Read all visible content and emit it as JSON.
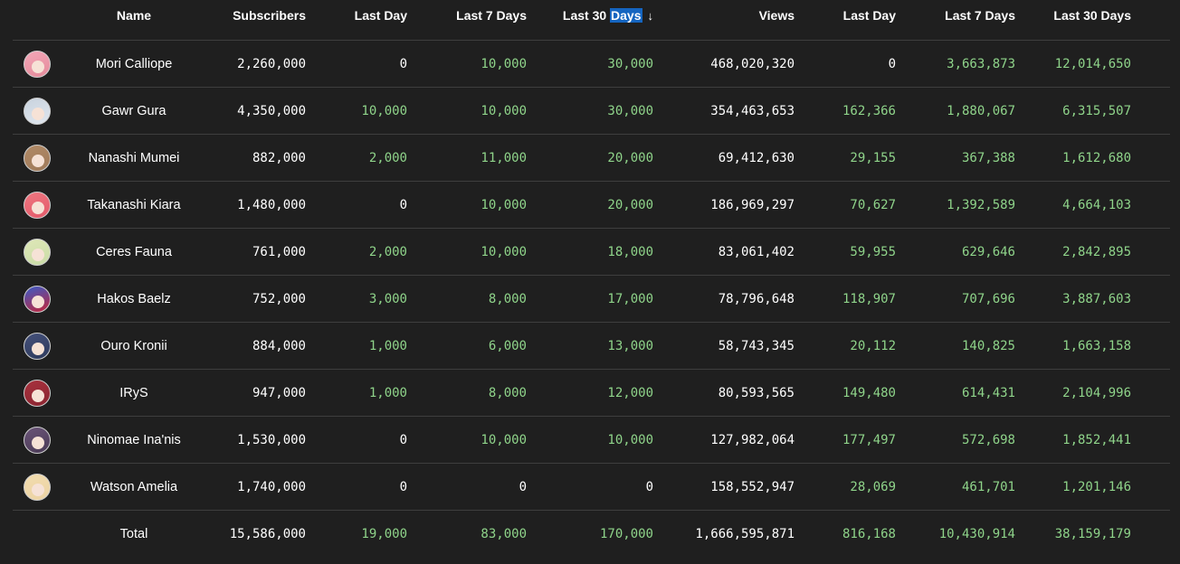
{
  "header": {
    "name": "Name",
    "subscribers": "Subscribers",
    "sub_last_day": "Last Day",
    "sub_last_7": "Last 7 Days",
    "sub_last_30_prefix": "Last 30 ",
    "sub_last_30_highlight": "Days",
    "sort_arrow": "↓",
    "views": "Views",
    "view_last_day": "Last Day",
    "view_last_7": "Last 7 Days",
    "view_last_30": "Last 30 Days"
  },
  "rows": [
    {
      "name": "Mori Calliope",
      "subs": "2,260,000",
      "sd1": "0",
      "sd7": "10,000",
      "sd30": "30,000",
      "views": "468,020,320",
      "vd1": "0",
      "vd7": "3,663,873",
      "vd30": "12,014,650",
      "avatar_bg": "#e58a9a",
      "avatar_hair": "#f2a7b8"
    },
    {
      "name": "Gawr Gura",
      "subs": "4,350,000",
      "sd1": "10,000",
      "sd7": "10,000",
      "sd30": "30,000",
      "views": "354,463,653",
      "vd1": "162,366",
      "vd7": "1,880,067",
      "vd30": "6,315,507",
      "avatar_bg": "#dfe6ee",
      "avatar_hair": "#c9d3de"
    },
    {
      "name": "Nanashi Mumei",
      "subs": "882,000",
      "sd1": "2,000",
      "sd7": "11,000",
      "sd30": "20,000",
      "views": "69,412,630",
      "vd1": "29,155",
      "vd7": "367,388",
      "vd30": "1,612,680",
      "avatar_bg": "#a07a5a",
      "avatar_hair": "#b08a66"
    },
    {
      "name": "Takanashi Kiara",
      "subs": "1,480,000",
      "sd1": "0",
      "sd7": "10,000",
      "sd30": "20,000",
      "views": "186,969,297",
      "vd1": "70,627",
      "vd7": "1,392,589",
      "vd30": "4,664,103",
      "avatar_bg": "#e35a6a",
      "avatar_hair": "#ee7680"
    },
    {
      "name": "Ceres Fauna",
      "subs": "761,000",
      "sd1": "2,000",
      "sd7": "10,000",
      "sd30": "18,000",
      "views": "83,061,402",
      "vd1": "59,955",
      "vd7": "629,646",
      "vd30": "2,842,895",
      "avatar_bg": "#c9dba6",
      "avatar_hair": "#dfe8b8"
    },
    {
      "name": "Hakos Baelz",
      "subs": "752,000",
      "sd1": "3,000",
      "sd7": "8,000",
      "sd30": "17,000",
      "views": "78,796,648",
      "vd1": "118,907",
      "vd7": "707,696",
      "vd30": "3,887,603",
      "avatar_bg": "#c2253a",
      "avatar_hair": "#3a5bc7"
    },
    {
      "name": "Ouro Kronii",
      "subs": "884,000",
      "sd1": "1,000",
      "sd7": "6,000",
      "sd30": "13,000",
      "views": "58,743,345",
      "vd1": "20,112",
      "vd7": "140,825",
      "vd30": "1,663,158",
      "avatar_bg": "#2e3a5c",
      "avatar_hair": "#44507a"
    },
    {
      "name": "IRyS",
      "subs": "947,000",
      "sd1": "1,000",
      "sd7": "8,000",
      "sd30": "12,000",
      "views": "80,593,565",
      "vd1": "149,480",
      "vd7": "614,431",
      "vd30": "2,104,996",
      "avatar_bg": "#8a2430",
      "avatar_hair": "#a8323e"
    },
    {
      "name": "Ninomae Ina'nis",
      "subs": "1,530,000",
      "sd1": "0",
      "sd7": "10,000",
      "sd30": "10,000",
      "views": "127,982,064",
      "vd1": "177,497",
      "vd7": "572,698",
      "vd30": "1,852,441",
      "avatar_bg": "#4a3a55",
      "avatar_hair": "#6a5478"
    },
    {
      "name": "Watson Amelia",
      "subs": "1,740,000",
      "sd1": "0",
      "sd7": "0",
      "sd30": "0",
      "views": "158,552,947",
      "vd1": "28,069",
      "vd7": "461,701",
      "vd30": "1,201,146",
      "avatar_bg": "#ecd3a4",
      "avatar_hair": "#f2dcae"
    }
  ],
  "total": {
    "label": "Total",
    "subs": "15,586,000",
    "sd1": "19,000",
    "sd7": "83,000",
    "sd30": "170,000",
    "views": "1,666,595,871",
    "vd1": "816,168",
    "vd7": "10,430,914",
    "vd30": "38,159,179"
  },
  "colors": {
    "background": "#1f1f1f",
    "positive": "#8fd48a",
    "zero": "#ffffff",
    "sort_highlight": "#1565c0",
    "divider": "#3e3e3e"
  }
}
